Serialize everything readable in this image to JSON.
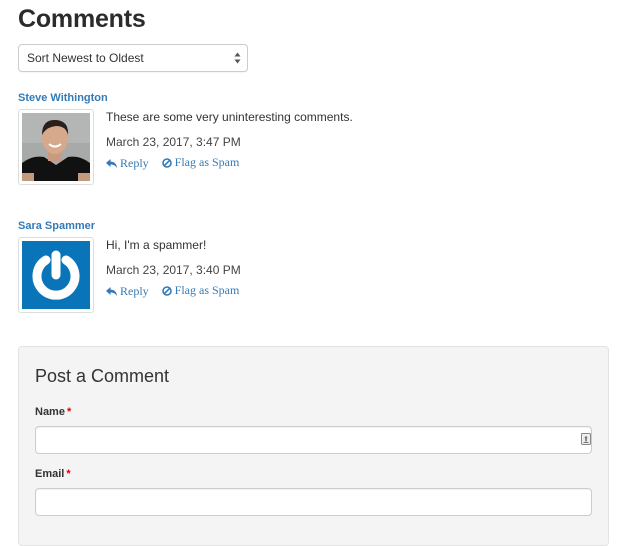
{
  "header": {
    "title": "Comments"
  },
  "sort": {
    "selected": "Sort Newest to Oldest"
  },
  "comments": [
    {
      "author": "Steve Withington",
      "avatar": "photo-avatar",
      "text": "These are some very uninteresting comments.",
      "date": "March 23, 2017, 3:47 PM",
      "reply_label": "Reply",
      "flag_label": "Flag as Spam"
    },
    {
      "author": "Sara Spammer",
      "avatar": "gravatar-default-icon",
      "text": "Hi, I'm a spammer!",
      "date": "March 23, 2017, 3:40 PM",
      "reply_label": "Reply",
      "flag_label": "Flag as Spam"
    }
  ],
  "post_form": {
    "title": "Post a Comment",
    "fields": [
      {
        "label": "Name",
        "required_marker": "*",
        "value": "",
        "placeholder": ""
      },
      {
        "label": "Email",
        "required_marker": "*",
        "value": "",
        "placeholder": ""
      }
    ]
  },
  "colors": {
    "link": "#337ab7",
    "required": "#e00000",
    "panel_bg": "#f4f4f4",
    "gravatar_blue": "#0a74b9"
  }
}
